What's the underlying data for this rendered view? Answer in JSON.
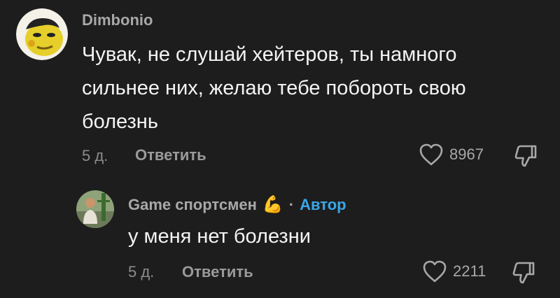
{
  "comments": [
    {
      "username": "Dimbonio",
      "lines": [
        "Чувак, не слушай хейтеров, ты намного",
        "сильнее них, желаю тебе побороть свою",
        "болезнь"
      ],
      "time": "5 д.",
      "reply_label": "Ответить",
      "likes": "8967",
      "avatar_icon": "yellow-cartoon-face-icon"
    }
  ],
  "replies": [
    {
      "username": "Game спортсмен",
      "emoji": "💪",
      "badge_separator": "·",
      "badge": "Автор",
      "text": "у меня нет болезни",
      "time": "5 д.",
      "reply_label": "Ответить",
      "likes": "2211",
      "avatar_icon": "person-photo-icon"
    }
  ],
  "colors": {
    "background": "#1d1d1d",
    "author_badge": "#3aa6e8",
    "secondary_text": "#a8a8a8"
  }
}
